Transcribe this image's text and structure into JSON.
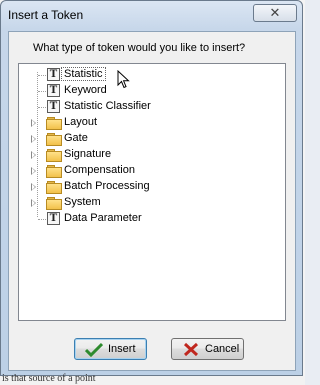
{
  "window": {
    "title": "Insert a Token"
  },
  "dialog": {
    "prompt": "What type of token would you like to insert?",
    "tree": [
      {
        "label": "Statistic",
        "icon": "token-icon",
        "expandable": false,
        "selected": true
      },
      {
        "label": "Keyword",
        "icon": "token-icon",
        "expandable": false,
        "selected": false
      },
      {
        "label": "Statistic Classifier",
        "icon": "token-icon",
        "expandable": false,
        "selected": false
      },
      {
        "label": "Layout",
        "icon": "folder-icon",
        "expandable": true,
        "selected": false
      },
      {
        "label": "Gate",
        "icon": "folder-icon",
        "expandable": true,
        "selected": false
      },
      {
        "label": "Signature",
        "icon": "folder-icon",
        "expandable": true,
        "selected": false
      },
      {
        "label": "Compensation",
        "icon": "folder-icon",
        "expandable": true,
        "selected": false
      },
      {
        "label": "Batch Processing",
        "icon": "folder-icon",
        "expandable": true,
        "selected": false
      },
      {
        "label": "System",
        "icon": "folder-icon",
        "expandable": true,
        "selected": false
      },
      {
        "label": "Data Parameter",
        "icon": "token-icon",
        "expandable": false,
        "selected": false
      }
    ],
    "buttons": {
      "insert": "Insert",
      "cancel": "Cancel"
    }
  },
  "background": {
    "partial_text": "is that source of a point"
  },
  "colors": {
    "checkmark": "#2e8b2e",
    "cancel_x": "#c0271e",
    "folder": "#f2c14a"
  }
}
